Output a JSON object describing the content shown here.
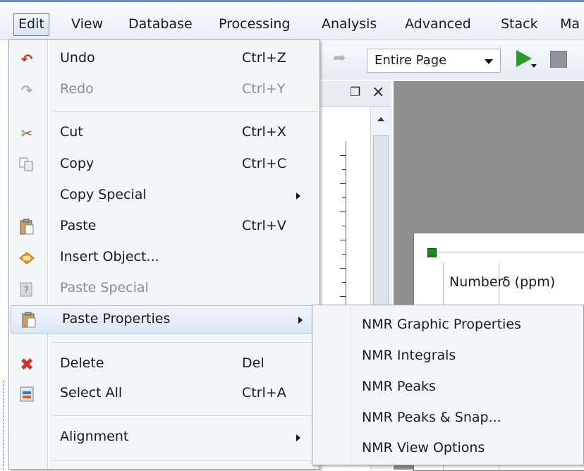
{
  "menubar": {
    "items": [
      "Edit",
      "View",
      "Database",
      "Processing",
      "Analysis",
      "Advanced",
      "Stack",
      "Ma"
    ]
  },
  "toolbar": {
    "zoom_select": "Entire Page",
    "icons": [
      "redo-icon",
      "play-icon",
      "stop-icon"
    ]
  },
  "document": {
    "table_headers": [
      "Number",
      "δ (ppm)"
    ]
  },
  "edit_menu": {
    "items": [
      {
        "label": "Undo",
        "shortcut": "Ctrl+Z",
        "icon": "undo-icon",
        "enabled": true
      },
      {
        "label": "Redo",
        "shortcut": "Ctrl+Y",
        "icon": "redo-icon",
        "enabled": false
      },
      {
        "label": "Cut",
        "shortcut": "Ctrl+X",
        "icon": "scissors-icon",
        "enabled": true
      },
      {
        "label": "Copy",
        "shortcut": "Ctrl+C",
        "icon": "copy-icon",
        "enabled": true
      },
      {
        "label": "Copy Special",
        "shortcut": "",
        "icon": "",
        "enabled": true,
        "submenu": true
      },
      {
        "label": "Paste",
        "shortcut": "Ctrl+V",
        "icon": "paste-icon",
        "enabled": true
      },
      {
        "label": "Insert Object...",
        "shortcut": "",
        "icon": "insert-object-icon",
        "enabled": true
      },
      {
        "label": "Paste Special",
        "shortcut": "",
        "icon": "paste-special-icon",
        "enabled": false
      },
      {
        "label": "Paste Properties",
        "shortcut": "",
        "icon": "paste-properties-icon",
        "enabled": true,
        "submenu": true,
        "highlighted": true
      },
      {
        "label": "Delete",
        "shortcut": "Del",
        "icon": "delete-icon",
        "enabled": true
      },
      {
        "label": "Select All",
        "shortcut": "Ctrl+A",
        "icon": "select-all-icon",
        "enabled": true
      },
      {
        "label": "Alignment",
        "shortcut": "",
        "icon": "",
        "enabled": true,
        "submenu": true
      }
    ]
  },
  "paste_properties_submenu": {
    "items": [
      "NMR Graphic Properties",
      "NMR Integrals",
      "NMR Peaks",
      "NMR Peaks & Snap...",
      "NMR View Options"
    ]
  },
  "colors": {
    "undo_red": "#c0392b",
    "delete_red": "#d0302a",
    "play_green": "#2a9a2a",
    "highlight": "#dde8f5"
  }
}
